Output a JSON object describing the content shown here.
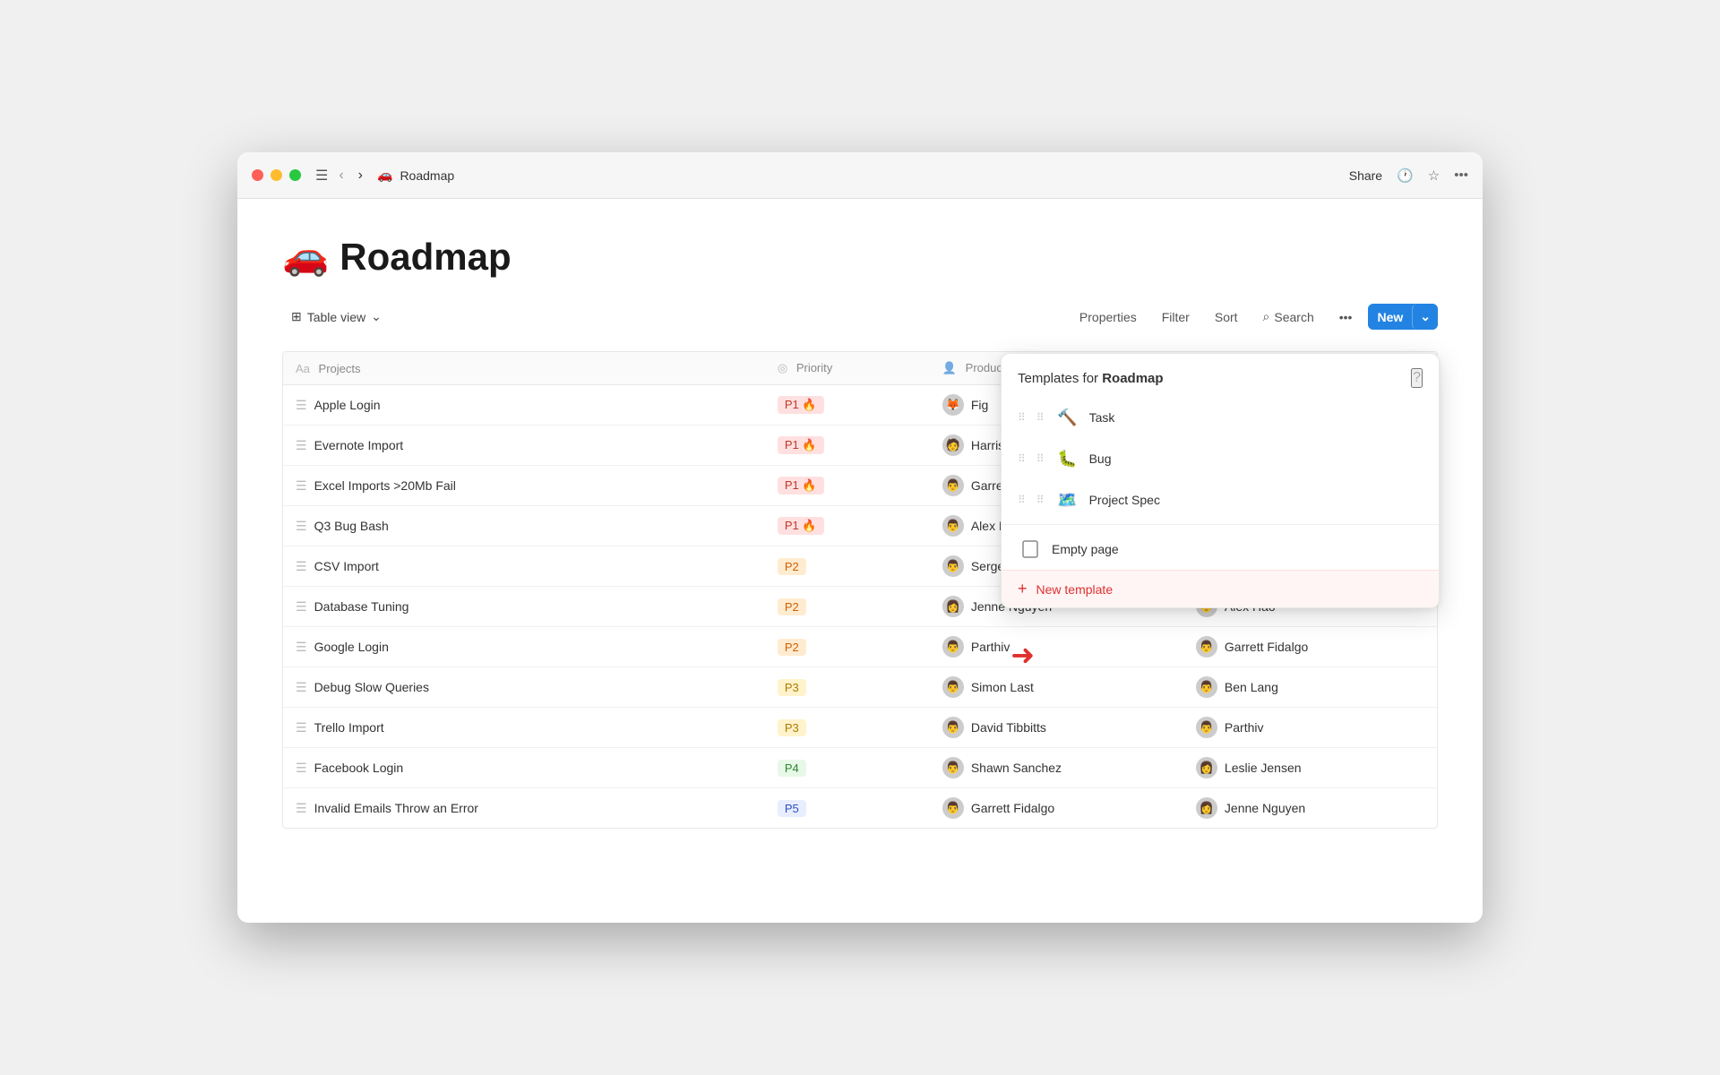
{
  "window": {
    "title": "Roadmap",
    "emoji": "🚗"
  },
  "titlebar": {
    "back_label": "‹",
    "forward_label": "›",
    "hamburger_label": "☰",
    "share_label": "Share",
    "history_icon": "🕐",
    "star_icon": "☆",
    "more_icon": "•••"
  },
  "toolbar": {
    "view_icon": "⊞",
    "view_label": "Table view",
    "view_chevron": "⌄",
    "properties_label": "Properties",
    "filter_label": "Filter",
    "sort_label": "Sort",
    "search_icon": "⌕",
    "search_label": "Search",
    "more_label": "•••",
    "new_label": "New",
    "new_dropdown": "⌄"
  },
  "table": {
    "columns": [
      {
        "id": "projects",
        "label": "Projects",
        "icon": "Aa"
      },
      {
        "id": "priority",
        "label": "Priority",
        "icon": "◎"
      },
      {
        "id": "product_manager",
        "label": "Product Man...",
        "icon": "👤"
      },
      {
        "id": "extra",
        "label": "",
        "icon": ""
      }
    ],
    "rows": [
      {
        "name": "Apple Login",
        "priority": "P1",
        "priority_class": "p1",
        "emoji": "🔥",
        "pm": "Fig",
        "pm_avatar": "🦊",
        "extra": "",
        "extra_avatar": ""
      },
      {
        "name": "Evernote Import",
        "priority": "P1",
        "priority_class": "p1",
        "emoji": "🔥",
        "pm": "Harrison Me...",
        "pm_avatar": "🧑",
        "extra": "",
        "extra_avatar": ""
      },
      {
        "name": "Excel Imports >20Mb Fail",
        "priority": "P1",
        "priority_class": "p1",
        "emoji": "🔥",
        "pm": "Garrett Fida...",
        "pm_avatar": "👨",
        "extra": "",
        "extra_avatar": ""
      },
      {
        "name": "Q3 Bug Bash",
        "priority": "P1",
        "priority_class": "p1",
        "emoji": "🔥",
        "pm": "Alex Hao",
        "pm_avatar": "👨",
        "extra": "",
        "extra_avatar": ""
      },
      {
        "name": "CSV Import",
        "priority": "P2",
        "priority_class": "p2",
        "emoji": "",
        "pm": "Sergey S...",
        "pm_avatar": "👨",
        "extra": "",
        "extra_avatar": ""
      },
      {
        "name": "Database Tuning",
        "priority": "P2",
        "priority_class": "p2",
        "emoji": "",
        "pm": "Jenne Nguyen",
        "pm_avatar": "👩",
        "extra": "Alex Hao",
        "extra_avatar": "👨"
      },
      {
        "name": "Google Login",
        "priority": "P2",
        "priority_class": "p2",
        "emoji": "",
        "pm": "Parthiv",
        "pm_avatar": "👨",
        "extra": "Garrett Fidalgo",
        "extra_avatar": "👨"
      },
      {
        "name": "Debug Slow Queries",
        "priority": "P3",
        "priority_class": "p3",
        "emoji": "",
        "pm": "Simon Last",
        "pm_avatar": "👨",
        "extra": "Ben Lang",
        "extra_avatar": "👨"
      },
      {
        "name": "Trello Import",
        "priority": "P3",
        "priority_class": "p3",
        "emoji": "",
        "pm": "David Tibbitts",
        "pm_avatar": "👨",
        "extra": "Parthiv",
        "extra_avatar": "👨"
      },
      {
        "name": "Facebook Login",
        "priority": "P4",
        "priority_class": "p4",
        "emoji": "",
        "pm": "Shawn Sanchez",
        "pm_avatar": "👨",
        "extra": "Leslie Jensen",
        "extra_avatar": "👩"
      },
      {
        "name": "Invalid Emails Throw an Error",
        "priority": "P5",
        "priority_class": "p5",
        "emoji": "",
        "pm": "Garrett Fidalgo",
        "pm_avatar": "👨",
        "extra": "Jenne Nguyen",
        "extra_avatar": "👩"
      }
    ]
  },
  "templates_dropdown": {
    "title_prefix": "Templates for",
    "title_page": "Roadmap",
    "help_icon": "?",
    "items": [
      {
        "id": "task",
        "icon": "🔨",
        "label": "Task",
        "has_drag": true
      },
      {
        "id": "bug",
        "icon": "🐛",
        "label": "Bug",
        "has_drag": true
      },
      {
        "id": "project-spec",
        "icon": "🗺️",
        "label": "Project Spec",
        "has_drag": true
      }
    ],
    "empty_page_label": "Empty page",
    "new_template_label": "New template",
    "new_template_prefix": "+"
  }
}
